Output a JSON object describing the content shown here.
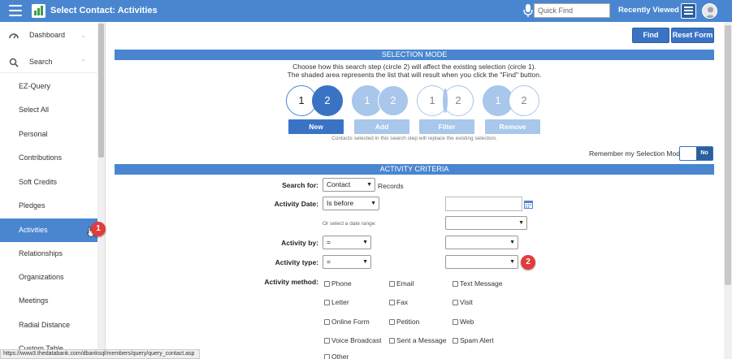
{
  "header": {
    "title": "Select Contact: Activities",
    "quick_find_placeholder": "Quick Find",
    "recently_viewed": "Recently Viewed"
  },
  "sidebar": {
    "dashboard": "Dashboard",
    "search": "Search",
    "items": [
      "EZ-Query",
      "Select All",
      "Personal",
      "Contributions",
      "Soft Credits",
      "Pledges",
      "Activities",
      "Relationships",
      "Organizations",
      "Meetings",
      "Radial Distance",
      "Custom Table"
    ],
    "active_index": 6
  },
  "actions": {
    "find": "Find",
    "reset": "Reset Form"
  },
  "selection_mode": {
    "heading": "SELECTION MODE",
    "line1": "Choose how this search step (circle 2) will affect the existing selection (circle 1).",
    "line2": "The shaded area represents the list that will result when you click the \"Find\" button.",
    "circle_1": "1",
    "circle_2": "2",
    "modes": [
      "New",
      "Add",
      "Filter",
      "Remove"
    ],
    "selected_mode": "New",
    "note": "Contacts selected in this search step will replace the existing selection.",
    "remember_label": "Remember my Selection Mode",
    "remember_value": "No"
  },
  "criteria": {
    "heading": "ACTIVITY CRITERIA",
    "search_for_label": "Search for:",
    "search_for_value": "Contact",
    "records_label": "Records",
    "activity_date_label": "Activity Date:",
    "activity_date_value": "Is before",
    "date_range_label": "Or select a date range:",
    "activity_by_label": "Activity by:",
    "activity_by_operator": "=",
    "activity_type_label": "Activity type:",
    "activity_type_operator": "=",
    "activity_method_label": "Activity method:",
    "methods": [
      "Phone",
      "Email",
      "Text Message",
      "Letter",
      "Fax",
      "Visit",
      "Online Form",
      "Petition",
      "Web",
      "Voice Broadcast",
      "Sent a Message",
      "Spam Alert",
      "Other"
    ]
  },
  "annotations": {
    "badge_1": "1",
    "badge_2": "2"
  },
  "status_url": "https://www3.thedatabank.com/dbanksql/members/query/query_contact.asp",
  "colors": {
    "primary": "#4a86d0",
    "button": "#3b73c4",
    "badge": "#e33b3b",
    "muted": "#a9c6eb"
  }
}
